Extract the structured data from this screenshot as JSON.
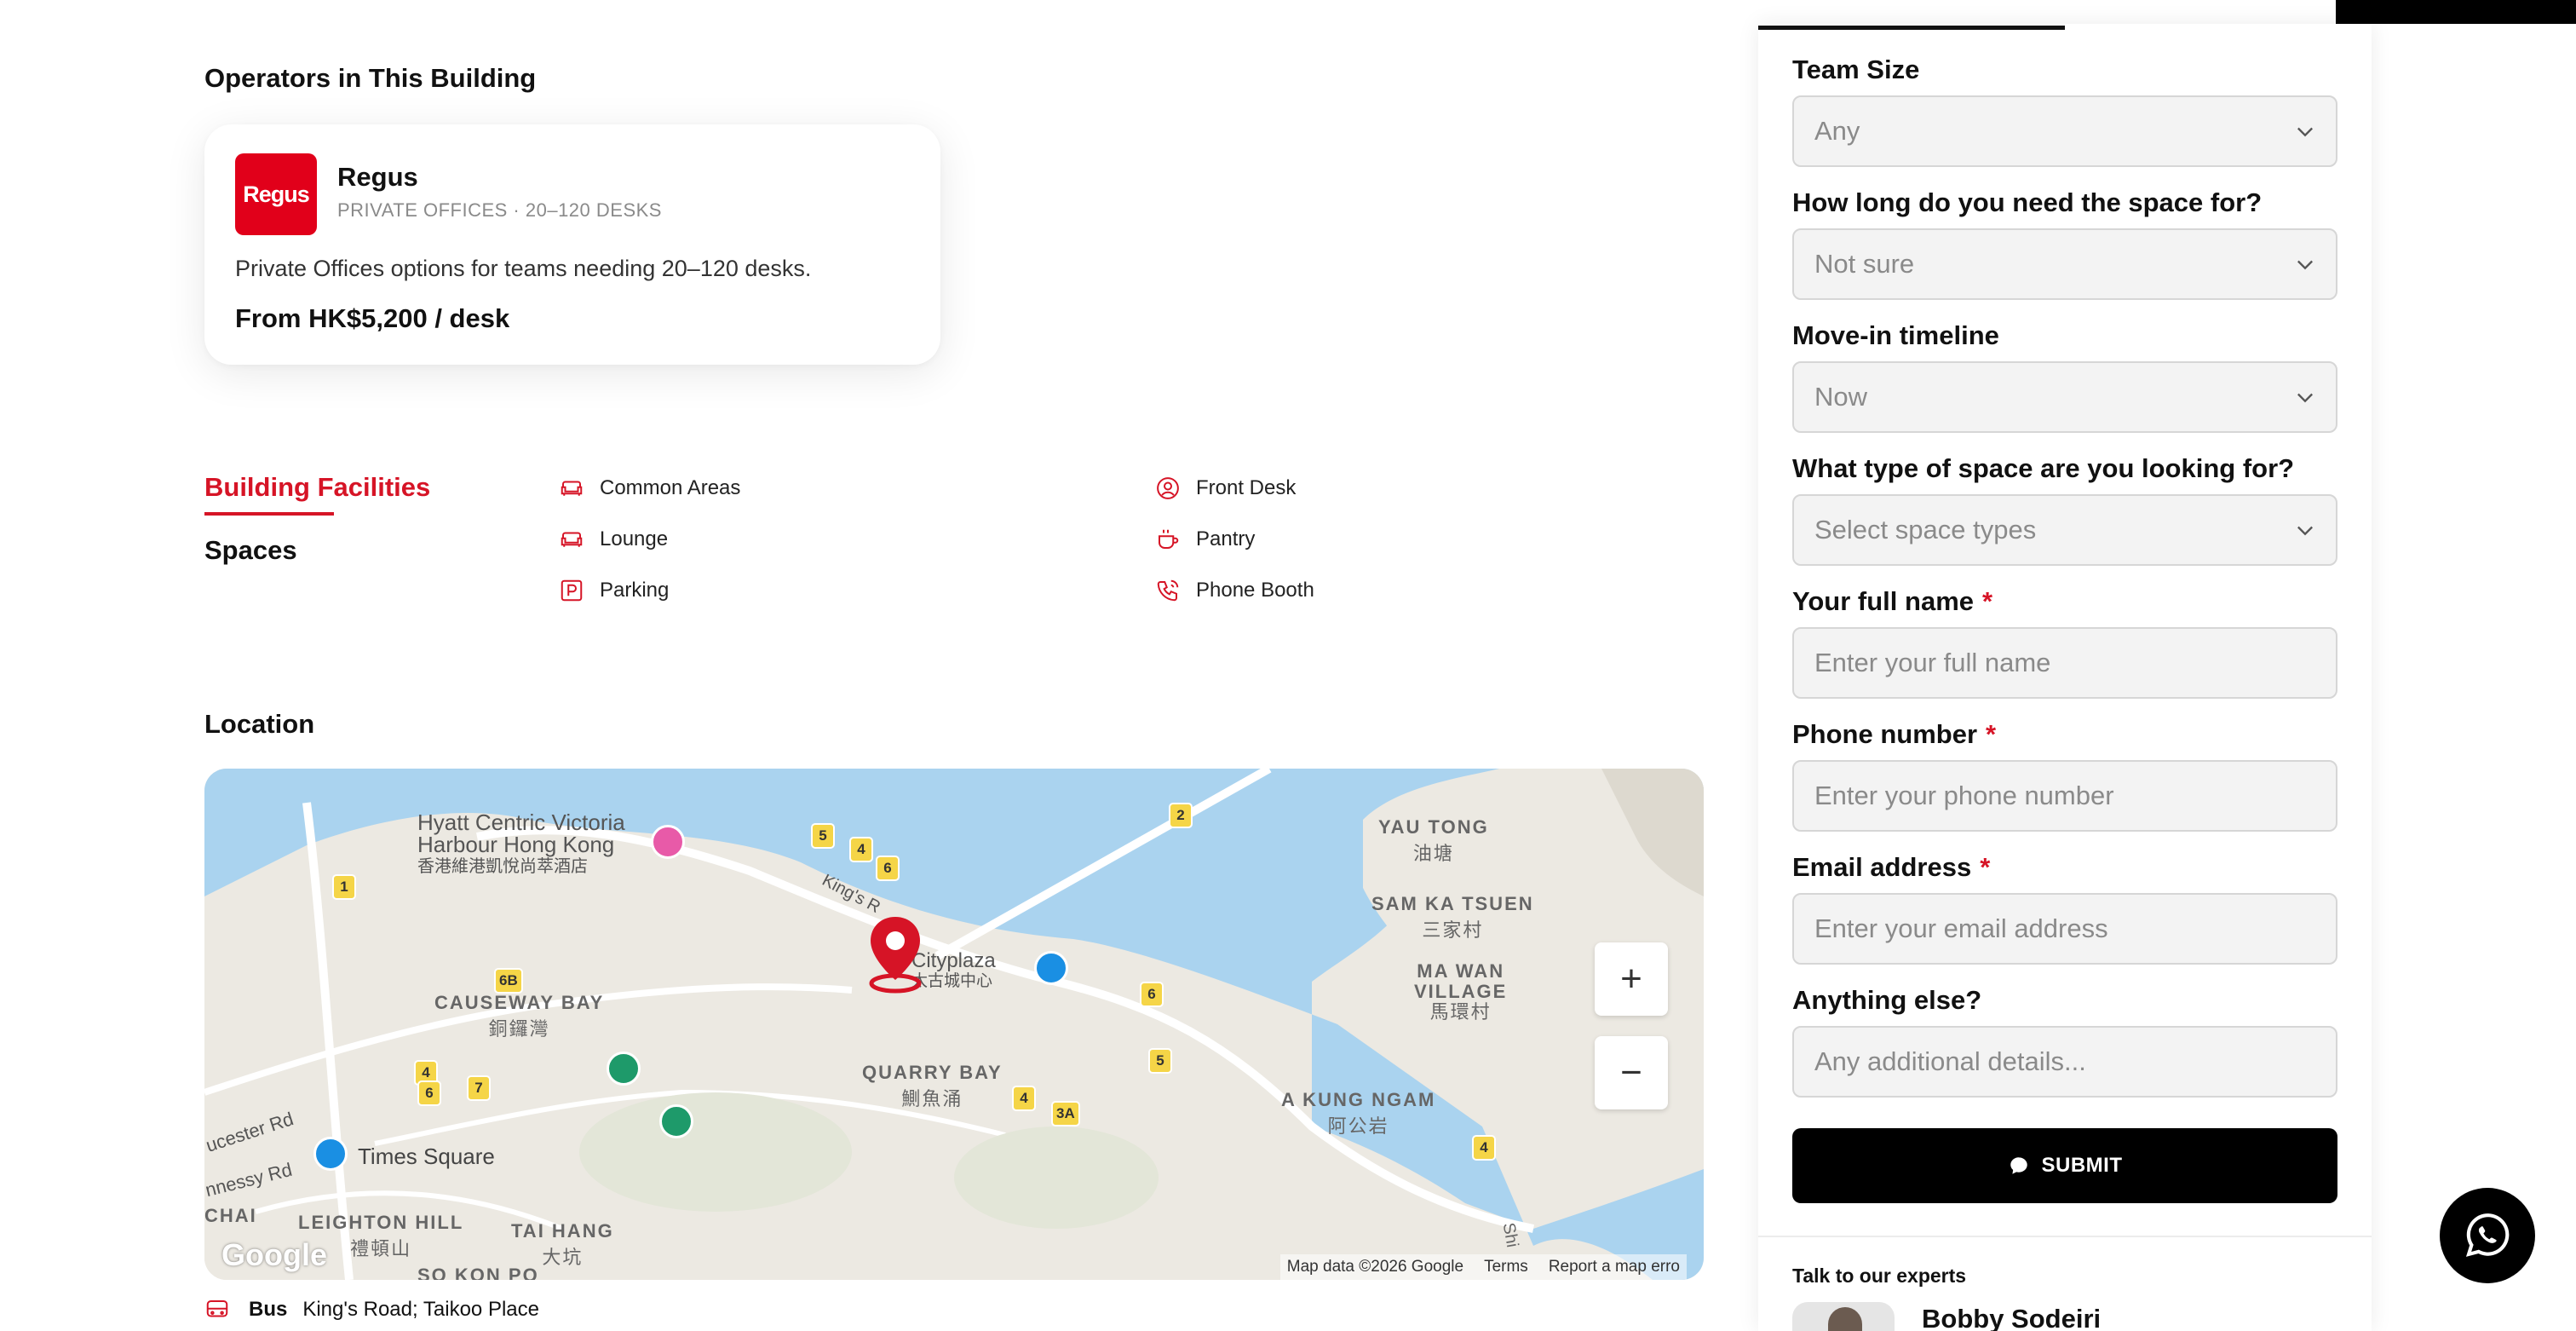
{
  "operators": {
    "title": "Operators in This Building",
    "card": {
      "logo_text": "Regus",
      "name": "Regus",
      "meta": "PRIVATE OFFICES · 20–120 DESKS",
      "description": "Private Offices options for teams needing 20–120 desks.",
      "price": "From HK$5,200 / desk"
    }
  },
  "tabs": {
    "facilities": "Building Facilities",
    "spaces": "Spaces"
  },
  "facilities": [
    {
      "label": "Common Areas",
      "icon": "sofa-icon"
    },
    {
      "label": "Lounge",
      "icon": "sofa-icon"
    },
    {
      "label": "Parking",
      "icon": "parking-icon"
    },
    {
      "label": "Front Desk",
      "icon": "person-icon"
    },
    {
      "label": "Pantry",
      "icon": "coffee-icon"
    },
    {
      "label": "Phone Booth",
      "icon": "phone-icon"
    }
  ],
  "location": {
    "title": "Location",
    "map": {
      "labels": {
        "hyatt": "Hyatt Centric Victoria",
        "hyatt2": "Harbour Hong Kong",
        "hyatt_cn": "香港維港凱悅尚萃酒店",
        "causeway": "CAUSEWAY BAY",
        "causeway_cn": "銅鑼灣",
        "yau_tong": "YAU TONG",
        "yau_tong_cn": "油塘",
        "sam_ka": "SAM KA TSUEN",
        "sam_ka_cn": "三家村",
        "ma_wan": "MA WAN",
        "village": "VILLAGE",
        "ma_wan_cn": "馬環村",
        "quarry": "QUARRY BAY",
        "quarry_cn": "鰂魚涌",
        "cityplaza": "Cityplaza",
        "cityplaza_cn": "太古城中心",
        "kung_ngam": "A KUNG NGAM",
        "kung_ngam_cn": "阿公岩",
        "times_square": "Times Square",
        "leighton": "LEIGHTON HILL",
        "leighton_cn": "禮頓山",
        "tai_hang": "TAI HANG",
        "tai_hang_cn": "大坑",
        "so_kon_po": "SO KON PO",
        "gloucester": "ucester Rd",
        "hennessy": "nnessy Rd",
        "chai": "CHAI",
        "kings_road": "King's R",
        "shi": "Shi"
      },
      "route_badges": [
        "1",
        "5",
        "4",
        "6",
        "2",
        "6B",
        "4",
        "7",
        "6",
        "6",
        "5",
        "4",
        "3A",
        "4"
      ],
      "google": "Google",
      "attribution": [
        "Map data ©2026 Google",
        "Terms",
        "Report a map erro"
      ]
    },
    "transport": {
      "type": "Bus",
      "stops": "King's Road; Taikoo Place"
    }
  },
  "form": {
    "fields": [
      {
        "label": "Team Size",
        "value": "Any",
        "kind": "select"
      },
      {
        "label": "How long do you need the space for?",
        "value": "Not sure",
        "kind": "select"
      },
      {
        "label": "Move-in timeline",
        "value": "Now",
        "kind": "select"
      },
      {
        "label": "What type of space are you looking for?",
        "value": "Select space types",
        "kind": "select"
      },
      {
        "label": "Your full name",
        "placeholder": "Enter your full name",
        "required": "*"
      },
      {
        "label": "Phone number",
        "placeholder": "Enter your phone number",
        "required": "*"
      },
      {
        "label": "Email address",
        "placeholder": "Enter your email address",
        "required": "*"
      },
      {
        "label": "Anything else?",
        "placeholder": "Any additional details..."
      }
    ],
    "submit": "SUBMIT",
    "talk_title": "Talk to our experts",
    "expert_name": "Bobby Sodeiri"
  },
  "colors": {
    "accent": "#d61426",
    "brand_red": "#e1001a",
    "water": "#a9d3ef",
    "land": "#ece9e2"
  }
}
